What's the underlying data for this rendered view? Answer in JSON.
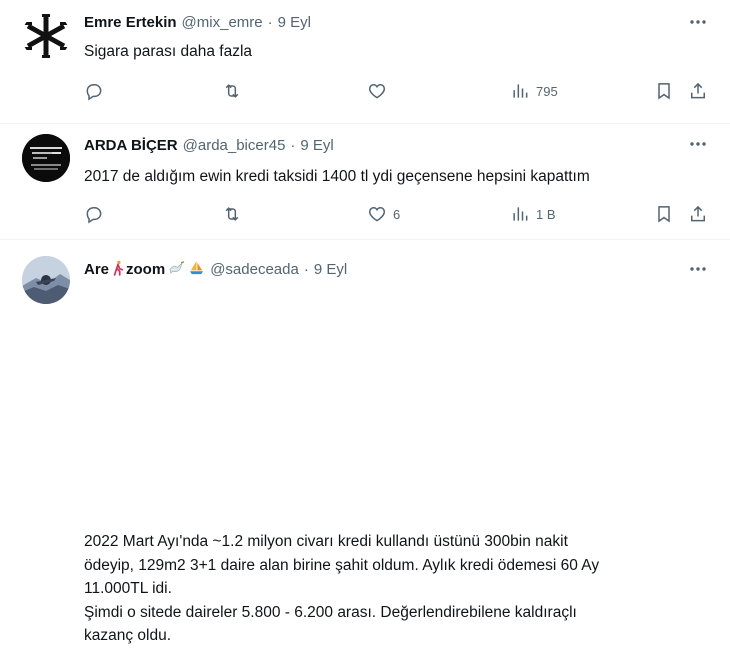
{
  "tweets": [
    {
      "name": "Emre Ertekin",
      "handle": "@mix_emre",
      "dot": "·",
      "time": "9 Eyl",
      "lines": [
        "Sigara parası daha fazla"
      ],
      "likes": "",
      "views": "795",
      "avatar_icon": "asterisk-logo-icon"
    },
    {
      "name": "ARDA BİÇER",
      "handle": "@arda_bicer45",
      "dot": "·",
      "time": "9 Eyl",
      "lines": [
        "2017 de aldığım ewin kredi taksidi 1400 tl ydi geçensene hepsini kapattım"
      ],
      "likes": "6",
      "views": "1 B"
    },
    {
      "name": "Are",
      "name_suffix": "zoom",
      "handle": "@sadeceada",
      "dot": "·",
      "time": "9 Eyl",
      "lines": [
        "2022 Mart Ayı'nda ~1.2 milyon civarı kredi kullandı üstünü 300bin nakit",
        "ödeyip, 129m2  3+1 daire alan birine şahit oldum. Aylık kredi ödemesi 60 Ay",
        "11.000TL idi.",
        "Şimdi o sitede daireler 5.800 - 6.200 arası. Değerlendirebilene kaldıraçlı",
        "kazanç oldu."
      ]
    }
  ],
  "colors": {
    "text": "#0f1419",
    "secondary": "#536471",
    "divider": "#eff3f4"
  }
}
